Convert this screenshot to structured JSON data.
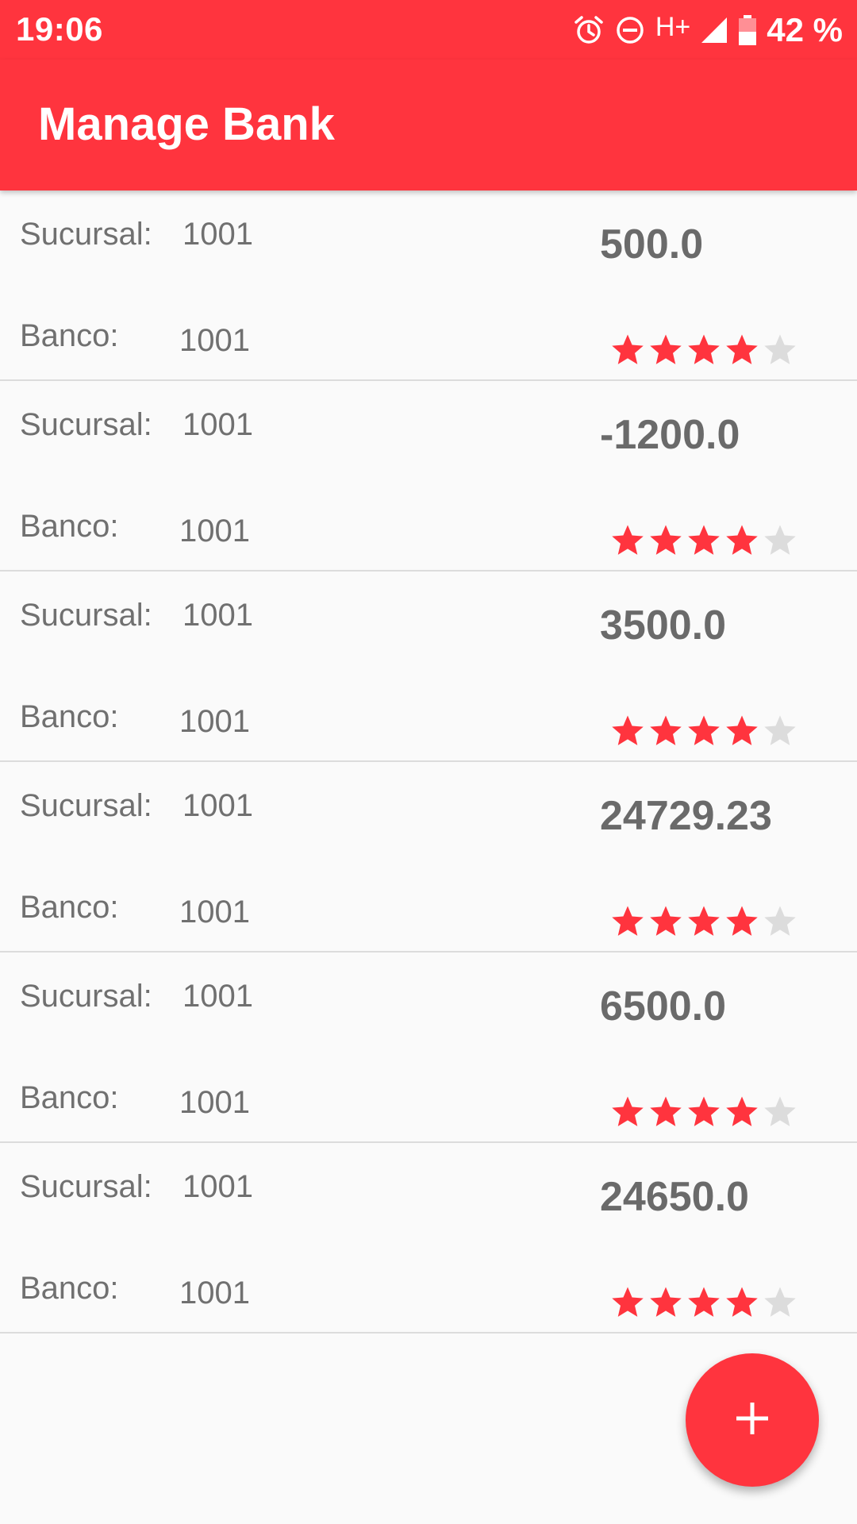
{
  "status_bar": {
    "time": "19:06",
    "icons": [
      "alarm-icon",
      "do-not-disturb-icon",
      "signal-icon",
      "battery-icon"
    ],
    "network": "H+",
    "battery_percent": "42 %"
  },
  "app_bar": {
    "title": "Manage Bank",
    "color": "#ff343e"
  },
  "accounts": [
    {
      "sucursal_label": "Sucursal:",
      "sucursal": "1001",
      "banco_label": "Banco:",
      "banco": "1001",
      "amount": "500.0",
      "rating": 4,
      "rating_max": 5
    },
    {
      "sucursal_label": "Sucursal:",
      "sucursal": "1001",
      "banco_label": "Banco:",
      "banco": "1001",
      "amount": "-1200.0",
      "rating": 4,
      "rating_max": 5
    },
    {
      "sucursal_label": "Sucursal:",
      "sucursal": "1001",
      "banco_label": "Banco:",
      "banco": "1001",
      "amount": "3500.0",
      "rating": 4,
      "rating_max": 5
    },
    {
      "sucursal_label": "Sucursal:",
      "sucursal": "1001",
      "banco_label": "Banco:",
      "banco": "1001",
      "amount": "24729.23",
      "rating": 4,
      "rating_max": 5
    },
    {
      "sucursal_label": "Sucursal:",
      "sucursal": "1001",
      "banco_label": "Banco:",
      "banco": "1001",
      "amount": "6500.0",
      "rating": 4,
      "rating_max": 5
    },
    {
      "sucursal_label": "Sucursal:",
      "sucursal": "1001",
      "banco_label": "Banco:",
      "banco": "1001",
      "amount": "24650.0",
      "rating": 4,
      "rating_max": 5
    }
  ],
  "fab": {
    "icon": "plus-icon"
  },
  "colors": {
    "accent": "#ff343e",
    "star_on": "#ff343e",
    "star_off": "#dcdcdc"
  }
}
